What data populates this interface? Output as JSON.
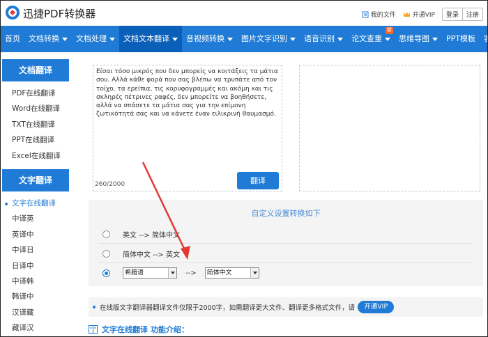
{
  "header": {
    "brand": "迅捷PDF转换器",
    "my_files": "我的文件",
    "vip": "开通VIP",
    "login": "登录",
    "register": "注册"
  },
  "nav": {
    "items": [
      {
        "label": "首页",
        "caret": false
      },
      {
        "label": "文档转换",
        "caret": true
      },
      {
        "label": "文档处理",
        "caret": true
      },
      {
        "label": "文档文本翻译",
        "caret": true,
        "active": true
      },
      {
        "label": "音视频转换",
        "caret": true
      },
      {
        "label": "图片文字识别",
        "caret": true
      },
      {
        "label": "语音识别",
        "caret": true
      },
      {
        "label": "论文查重",
        "caret": true,
        "badge": "新"
      },
      {
        "label": "思维导图",
        "caret": true
      },
      {
        "label": "PPT模板",
        "caret": false
      },
      {
        "label": "客户端",
        "caret": true
      }
    ]
  },
  "sidebar": {
    "doc_head": "文档翻译",
    "doc_items": [
      "PDF在线翻译",
      "Word在线翻译",
      "TXT在线翻译",
      "PPT在线翻译",
      "Excel在线翻译"
    ],
    "text_head": "文字翻译",
    "text_items": [
      "文字在线翻译",
      "中译英",
      "英译中",
      "中译日",
      "日译中",
      "中译韩",
      "韩译中",
      "汉译藏",
      "藏译汉"
    ]
  },
  "main": {
    "source_text": "Είσαι τόσο μικρός που δεν μπορείς να κοιτάξεις τα μάτια σου. Αλλά κάθε φορά που σας βλέπω να τρυπάτε από τον τοίχο, τα ερείπια, τις κορυφογραμμές και ακόμη και τις σκληρές πέτρινες ραφές, δεν μπορείτε να βοηθήσετε, αλλά να σπάσετε τα μάτια σας για την επίμονη ζωτικότητά σας και να κάνετε έναν ειλικρινή θαυμασμό.",
    "counter": "260/2000",
    "translate_btn": "翻译",
    "target_text": ""
  },
  "options": {
    "title": "自定义设置转换如下",
    "opt1": "英文 --> 简体中文",
    "opt2": "简体中文 --> 英文",
    "from_lang": "希腊语",
    "arrow": "-->",
    "to_lang": "简体中文",
    "selected": 3
  },
  "notice": {
    "text": "在线版文字翻译器翻译文件仅限于2000字，如需翻译更大文件、翻译更多格式文件，请",
    "vip_btn": "开通VIP"
  },
  "intro": {
    "title": "文字在线翻译 功能介绍："
  },
  "colors": {
    "primary": "#1f7bd6",
    "nav_active": "#0a5fb8",
    "annotation": "#e53935"
  }
}
